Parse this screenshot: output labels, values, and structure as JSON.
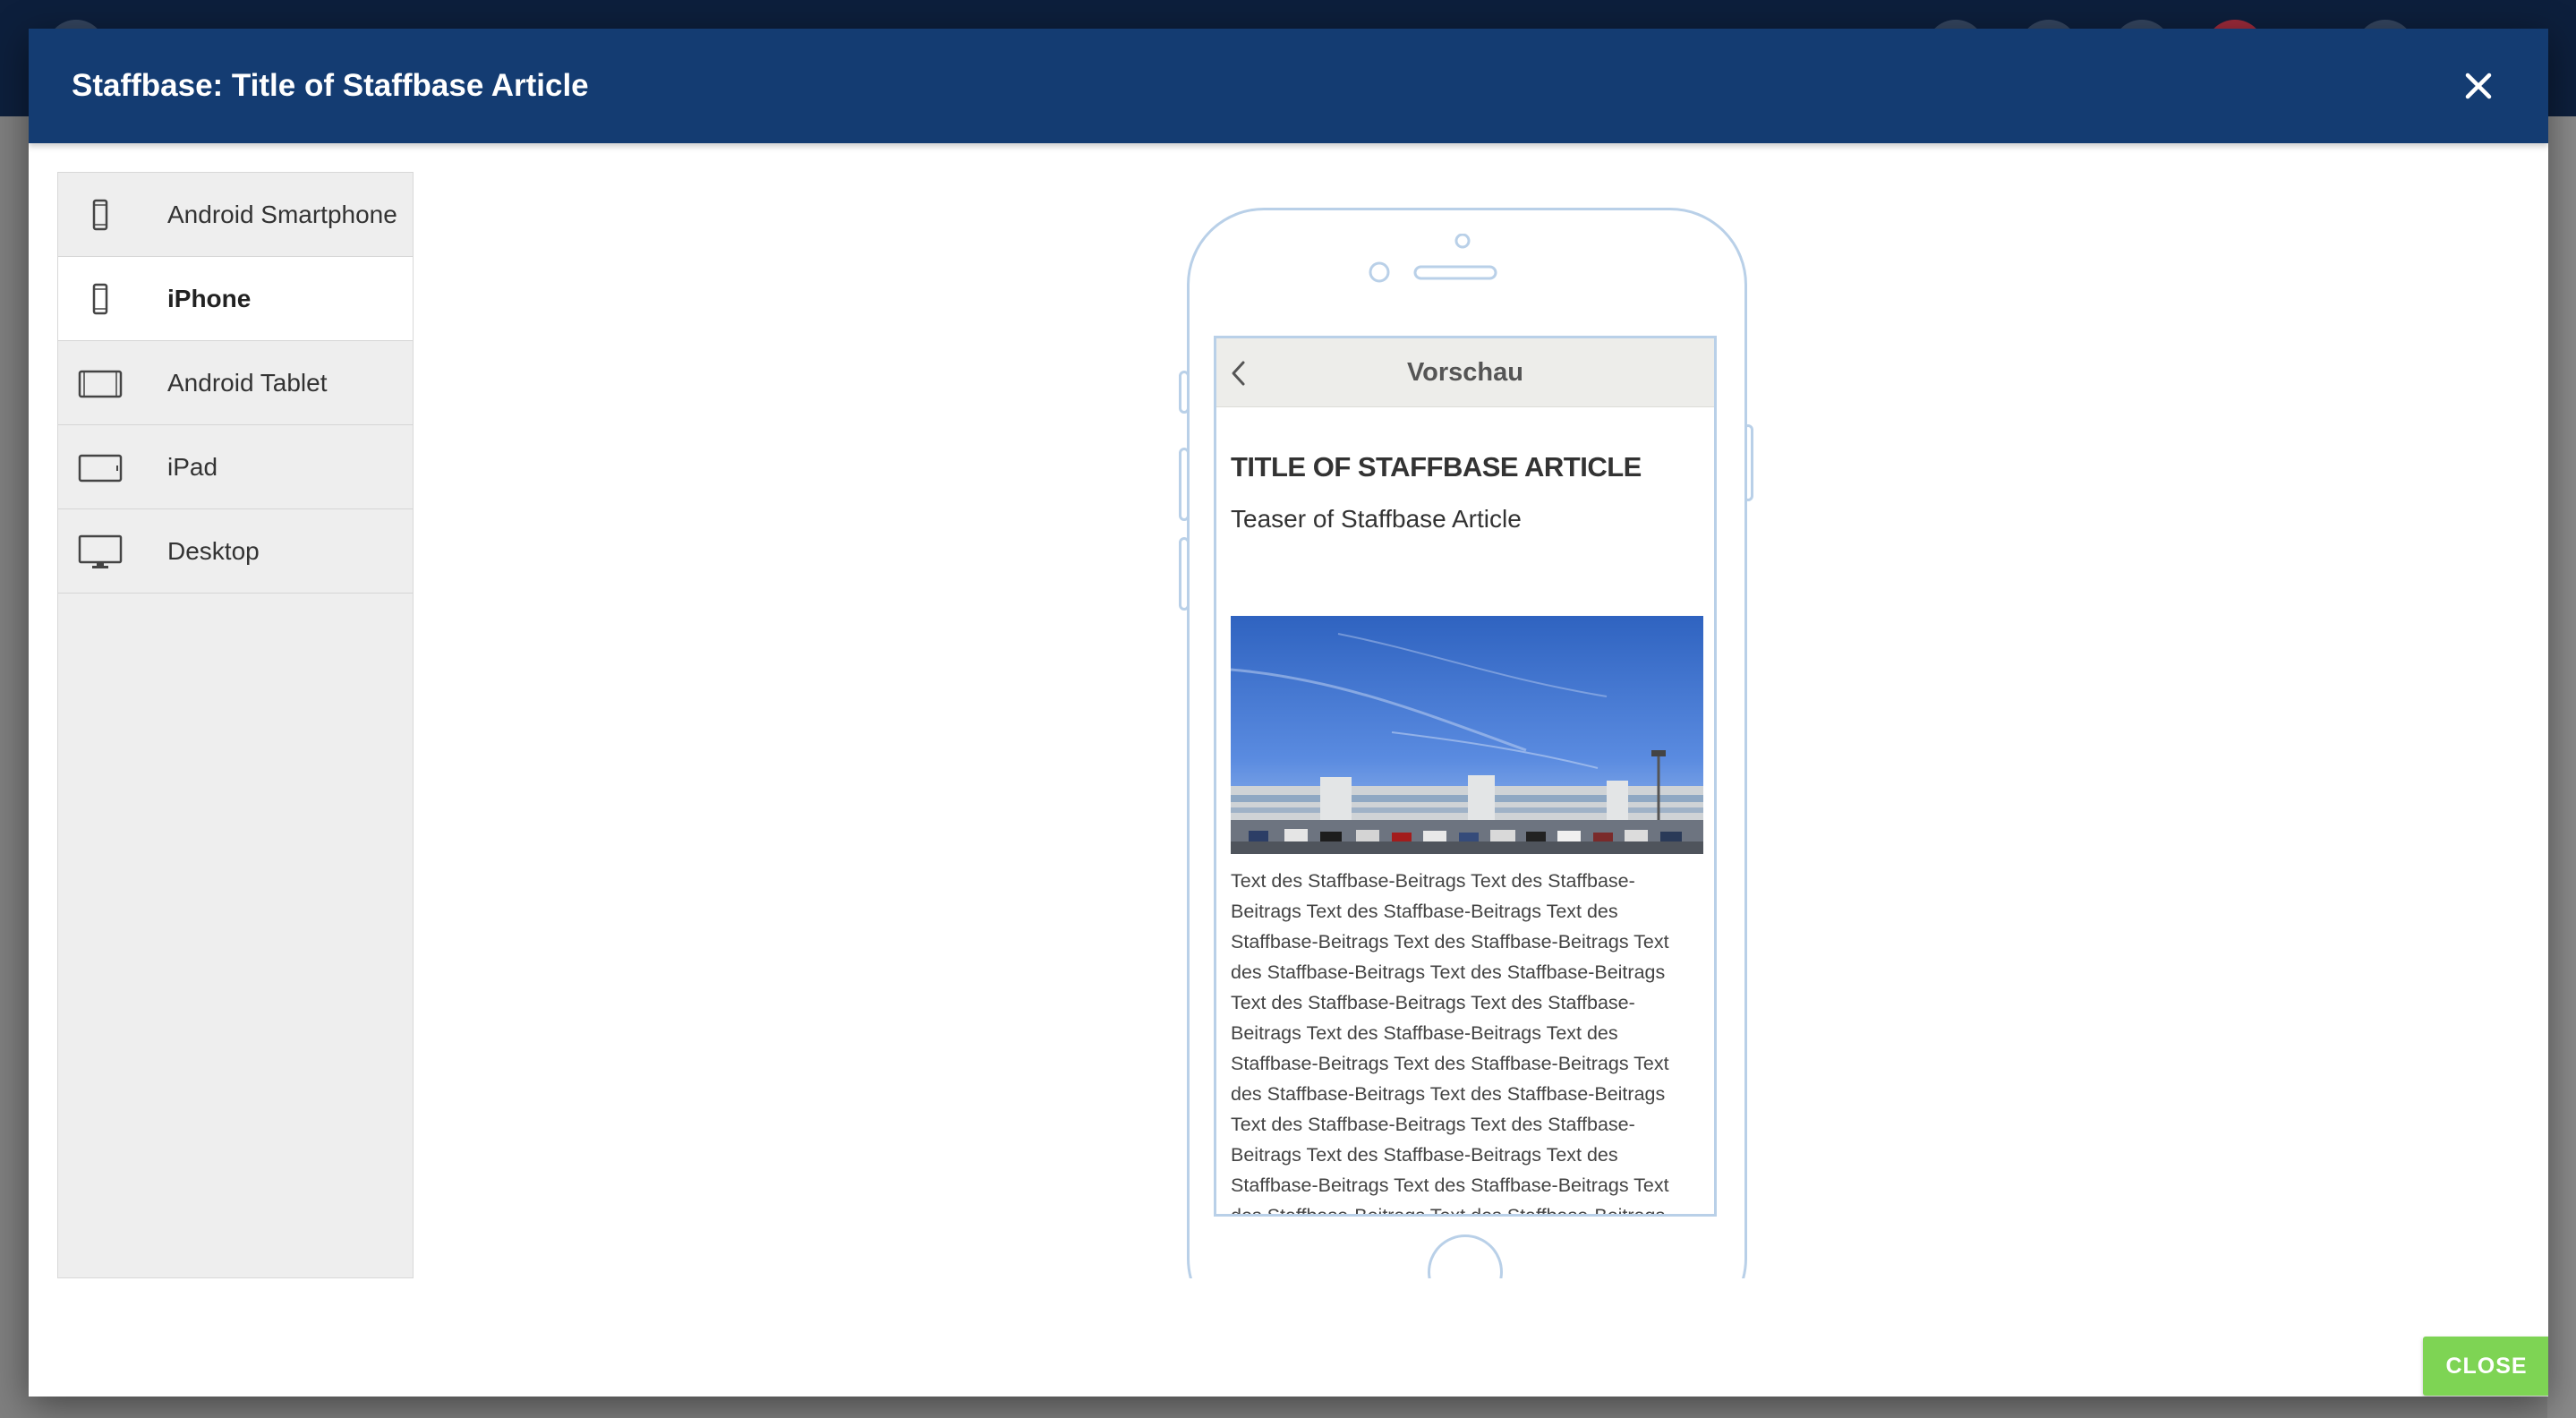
{
  "modal": {
    "title": "Staffbase: Title of Staffbase Article",
    "close_button_label": "CLOSE"
  },
  "devices": [
    {
      "label": "Android Smartphone",
      "icon": "smartphone-icon",
      "active": false
    },
    {
      "label": "iPhone",
      "icon": "smartphone-icon",
      "active": true
    },
    {
      "label": "Android Tablet",
      "icon": "tablet-icon",
      "active": false
    },
    {
      "label": "iPad",
      "icon": "tablet-icon",
      "active": false
    },
    {
      "label": "Desktop",
      "icon": "desktop-icon",
      "active": false
    }
  ],
  "preview": {
    "header_title": "Vorschau",
    "article_title": "TITLE OF STAFFBASE ARTICLE",
    "article_teaser": "Teaser of Staffbase Article",
    "article_body": "Text des Staffbase-Beitrags Text des Staffbase-Beitrags Text des Staffbase-Beitrags Text des Staffbase-Beitrags Text des Staffbase-Beitrags Text des Staffbase-Beitrags Text des Staffbase-Beitrags Text des Staffbase-Beitrags Text des Staffbase-Beitrags Text des Staffbase-Beitrags Text des Staffbase-Beitrags Text des Staffbase-Beitrags Text des Staffbase-Beitrags Text des Staffbase-Beitrags Text des Staffbase-Beitrags Text des Staffbase-Beitrags Text des Staffbase-Beitrags Text des Staffbase-Beitrags Text des Staffbase-Beitrags Text des Staffbase-Beitrags Text des Staffbase-Beitrags Text des Staffbase-"
  },
  "colors": {
    "header_bg": "#143c72",
    "close_button": "#7ed454",
    "device_outline": "#b9d0e8",
    "sidebar_bg": "#eeeeee"
  }
}
